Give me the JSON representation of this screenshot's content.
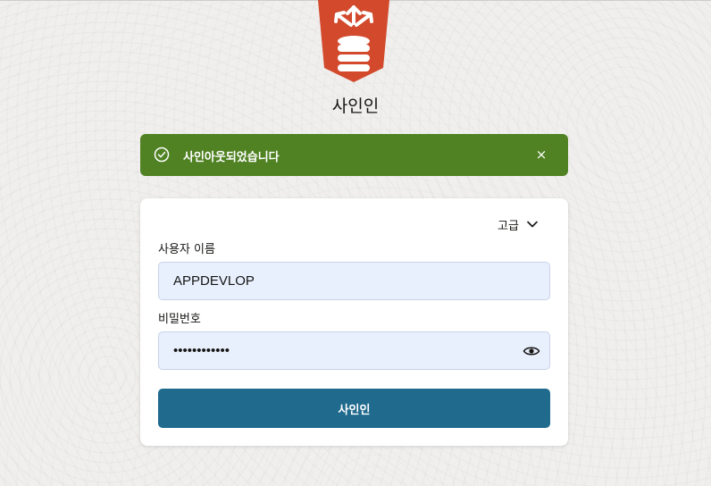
{
  "page": {
    "title": "사인인"
  },
  "alert": {
    "message": "사인아웃되었습니다",
    "close_label": "×",
    "color": "#508223"
  },
  "form": {
    "advanced_label": "고급",
    "username": {
      "label": "사용자 이름",
      "value": "APPDEVLOP"
    },
    "password": {
      "label": "비밀번호",
      "value": "••••••••••••"
    },
    "submit_label": "사인인",
    "button_color": "#1f6a8d"
  },
  "icons": {
    "logo": "database-arrows-logo",
    "alert": "check-circle-icon",
    "close": "close-icon",
    "advanced": "chevron-down-icon",
    "password_toggle": "eye-icon"
  }
}
